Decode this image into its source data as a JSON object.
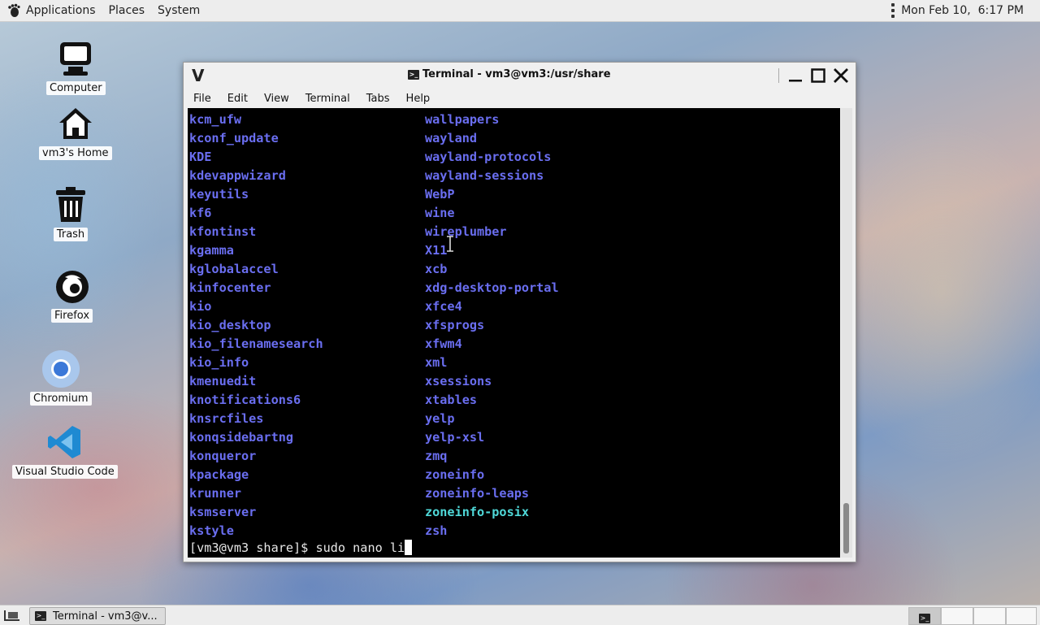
{
  "top_panel": {
    "menus": [
      "Applications",
      "Places",
      "System"
    ],
    "clock": "Mon Feb 10,  6:17 PM"
  },
  "desktop_icons": [
    {
      "label": "Computer",
      "icon": "computer-icon"
    },
    {
      "label": "vm3's Home",
      "icon": "home-icon"
    },
    {
      "label": "Trash",
      "icon": "trash-icon"
    },
    {
      "label": "Firefox",
      "icon": "firefox-icon"
    },
    {
      "label": "Chromium",
      "icon": "chromium-icon"
    },
    {
      "label": "Visual Studio Code",
      "icon": "vscode-icon"
    }
  ],
  "window": {
    "title": "Terminal - vm3@vm3:/usr/share",
    "menu": [
      "File",
      "Edit",
      "View",
      "Terminal",
      "Tabs",
      "Help"
    ]
  },
  "terminal": {
    "left_column": [
      "kcm_ufw",
      "kconf_update",
      "KDE",
      "kdevappwizard",
      "keyutils",
      "kf6",
      "kfontinst",
      "kgamma",
      "kglobalaccel",
      "kinfocenter",
      "kio",
      "kio_desktop",
      "kio_filenamesearch",
      "kio_info",
      "kmenuedit",
      "knotifications6",
      "knsrcfiles",
      "konqsidebartng",
      "konqueror",
      "kpackage",
      "krunner",
      "ksmserver",
      "kstyle"
    ],
    "right_column": [
      "wallpapers",
      "wayland",
      "wayland-protocols",
      "wayland-sessions",
      "WebP",
      "wine",
      "wireplumber",
      "X11",
      "xcb",
      "xdg-desktop-portal",
      "xfce4",
      "xfsprogs",
      "xfwm4",
      "xml",
      "xsessions",
      "xtables",
      "yelp",
      "yelp-xsl",
      "zmq",
      "zoneinfo",
      "zoneinfo-leaps",
      "zoneinfo-posix",
      "zsh"
    ],
    "link_entry": "zoneinfo-posix",
    "prompt": "[vm3@vm3 share]$ sudo nano li"
  },
  "taskbar": {
    "task_label": "Terminal - vm3@v..."
  },
  "colors": {
    "directory": "#6a6ef0",
    "symlink": "#4fd8d8",
    "terminal_bg": "#000000"
  }
}
